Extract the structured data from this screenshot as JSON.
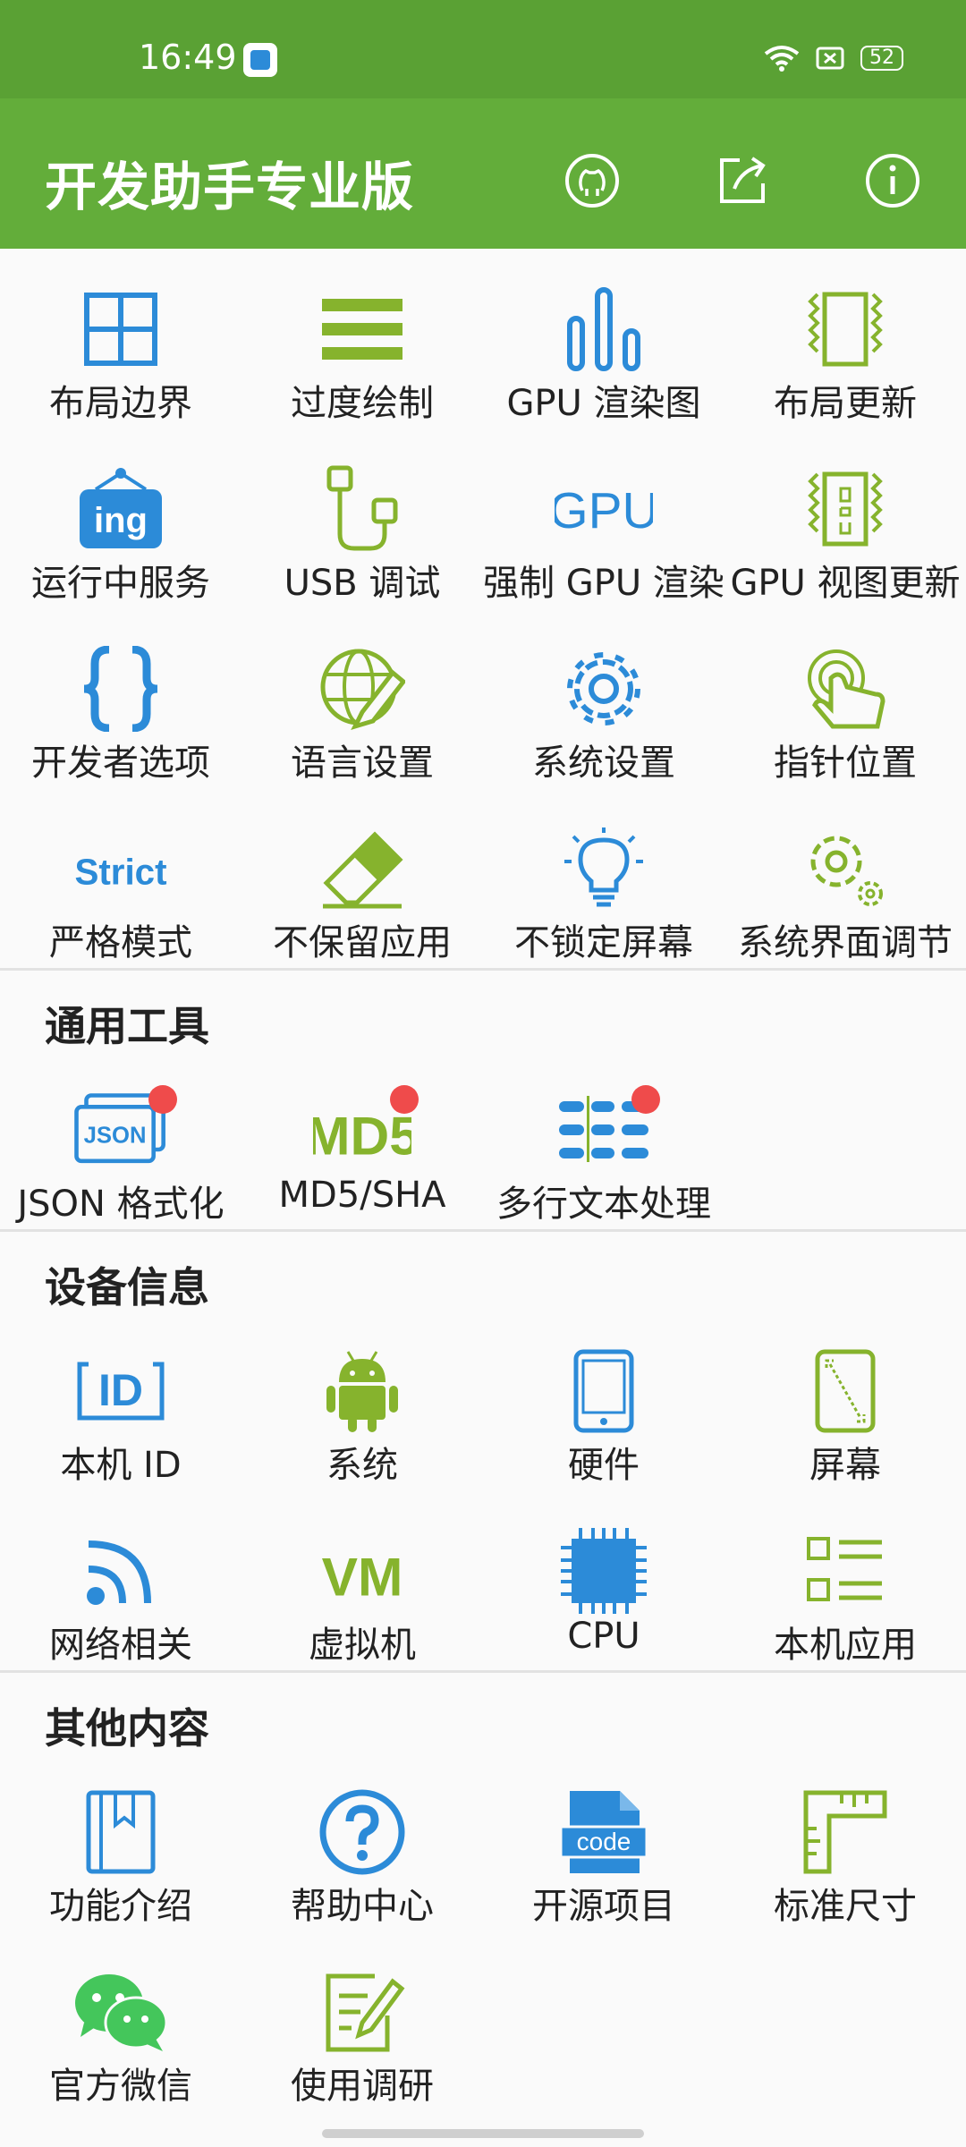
{
  "status": {
    "time": "16:49",
    "battery": "52"
  },
  "appbar": {
    "title": "开发助手专业版"
  },
  "sections": {
    "top": {
      "items": [
        {
          "label": "布局边界"
        },
        {
          "label": "过度绘制"
        },
        {
          "label": "GPU 渲染图"
        },
        {
          "label": "布局更新"
        },
        {
          "label": "运行中服务"
        },
        {
          "label": "USB 调试"
        },
        {
          "label": "强制 GPU 渲染"
        },
        {
          "label": "GPU 视图更新"
        },
        {
          "label": "开发者选项"
        },
        {
          "label": "语言设置"
        },
        {
          "label": "系统设置"
        },
        {
          "label": "指针位置"
        },
        {
          "label": "严格模式"
        },
        {
          "label": "不保留应用"
        },
        {
          "label": "不锁定屏幕"
        },
        {
          "label": "系统界面调节"
        }
      ]
    },
    "tools": {
      "title": "通用工具",
      "items": [
        {
          "label": "JSON 格式化"
        },
        {
          "label": "MD5/SHA"
        },
        {
          "label": "多行文本处理"
        }
      ]
    },
    "device": {
      "title": "设备信息",
      "items": [
        {
          "label": "本机 ID"
        },
        {
          "label": "系统"
        },
        {
          "label": "硬件"
        },
        {
          "label": "屏幕"
        },
        {
          "label": "网络相关"
        },
        {
          "label": "虚拟机"
        },
        {
          "label": "CPU"
        },
        {
          "label": "本机应用"
        }
      ]
    },
    "other": {
      "title": "其他内容",
      "items": [
        {
          "label": "功能介绍"
        },
        {
          "label": "帮助中心"
        },
        {
          "label": "开源项目"
        },
        {
          "label": "标准尺寸"
        },
        {
          "label": "官方微信"
        },
        {
          "label": "使用调研"
        }
      ]
    }
  },
  "icons": {
    "ing": "ing",
    "gpu": "GPU",
    "strict": "Strict",
    "json": "JSON",
    "md5": "MD5",
    "vm": "VM",
    "code": "code",
    "id": "ID"
  },
  "colors": {
    "appbar": "#63ad3a",
    "statusbar": "#5aa134",
    "blue": "#2c8bd8",
    "green": "#86b32d",
    "badge": "#ef4b4b"
  }
}
